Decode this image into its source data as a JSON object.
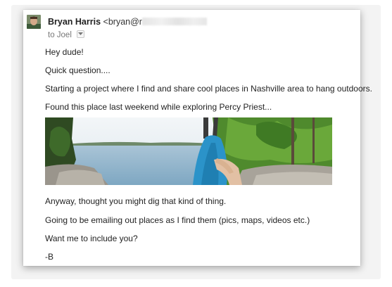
{
  "email": {
    "sender_name": "Bryan Harris",
    "sender_email_visible": "<bryan@r",
    "to_label": "to Joel",
    "body_lines": [
      "Hey dude!",
      "Quick question....",
      "Starting a project where I find and share cool places in Nashville area to hang outdoors.",
      "Found this place last weekend while exploring Percy Priest..."
    ],
    "body_lines_after_image": [
      "Anyway, thought you might dig that kind of thing.",
      "Going to be emailing out places as I find them (pics, maps, videos etc.)",
      "Want me to include you?",
      "-B"
    ]
  },
  "icons": {
    "avatar": "avatar-icon",
    "recipient_dropdown": "chevron-down-icon"
  },
  "colors": {
    "sky": "#e9eff4",
    "lake": "#8fb3cb",
    "hammock": "#2b93c9",
    "foliage": "#4f8a2d"
  }
}
